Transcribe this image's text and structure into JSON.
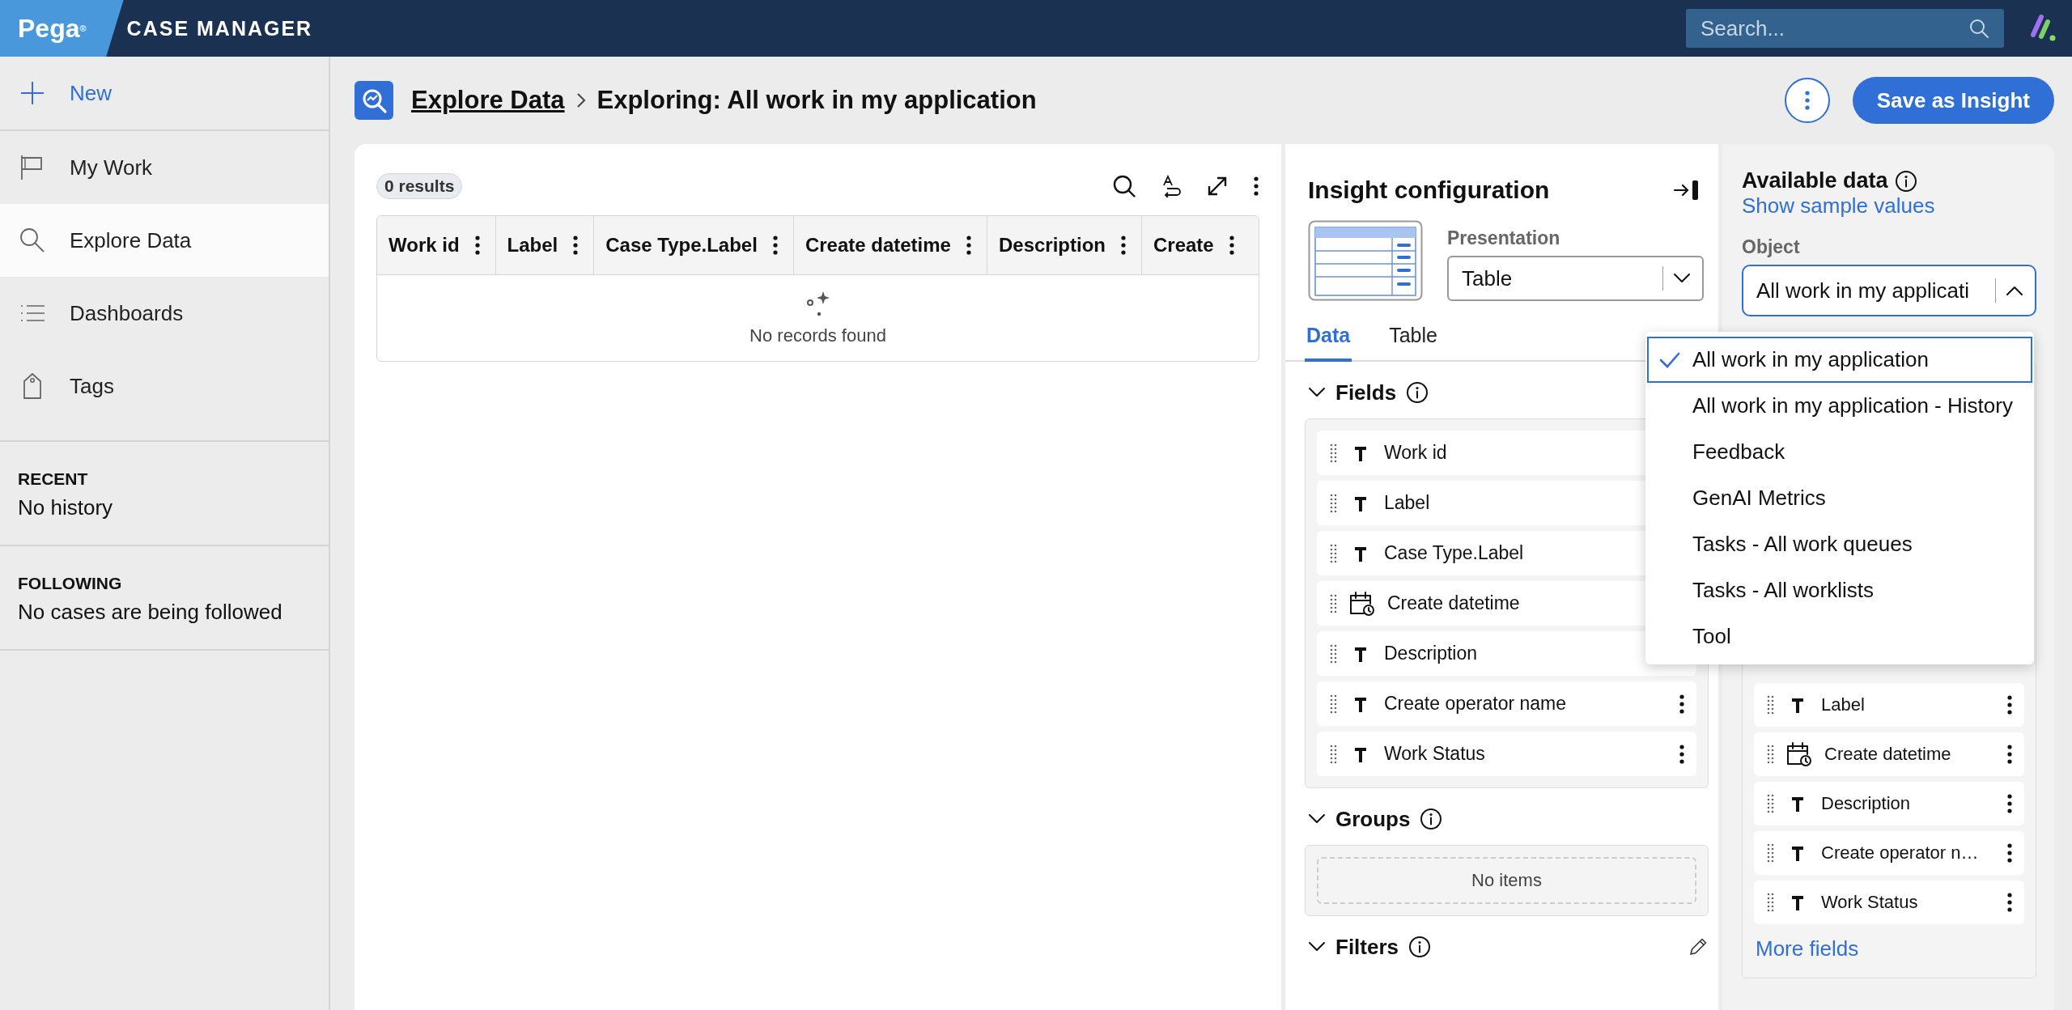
{
  "topbar": {
    "logo": "Pega$^{®}$",
    "app_title": "CASE MANAGER",
    "search": {
      "placeholder": "Search..."
    }
  },
  "sidebar": {
    "items": [
      {
        "label": "New",
        "kind": "new",
        "selected": false
      },
      {
        "label": "My Work",
        "kind": "flag",
        "selected": false
      },
      {
        "label": "Explore Data",
        "kind": "search",
        "selected": true
      },
      {
        "label": "Dashboards",
        "kind": "list",
        "selected": false
      },
      {
        "label": "Tags",
        "kind": "tag",
        "selected": false
      }
    ],
    "recent": {
      "heading": "RECENT",
      "text": "No history"
    },
    "following": {
      "heading": "FOLLOWING",
      "text": "No cases are being followed"
    }
  },
  "header": {
    "breadcrumb": "Explore Data",
    "title": "Exploring: All work in my application",
    "save_button": "Save as Insight"
  },
  "results": {
    "count": "0 results",
    "columns": [
      "Work id",
      "Label",
      "Case Type.Label",
      "Create datetime",
      "Description",
      "Create"
    ],
    "empty_text": "No records found"
  },
  "insight_config": {
    "title": "Insight configuration",
    "presentation": {
      "label": "Presentation",
      "value": "Table"
    },
    "tabs": [
      {
        "label": "Data",
        "selected": true
      },
      {
        "label": "Table",
        "selected": false
      }
    ],
    "fields": {
      "title": "Fields",
      "items": [
        {
          "label": "Work id",
          "kind": "text"
        },
        {
          "label": "Label",
          "kind": "text"
        },
        {
          "label": "Case Type.Label",
          "kind": "text"
        },
        {
          "label": "Create datetime",
          "kind": "datetime"
        },
        {
          "label": "Description",
          "kind": "text"
        },
        {
          "label": "Create operator name",
          "kind": "text"
        },
        {
          "label": "Work Status",
          "kind": "text"
        }
      ]
    },
    "groups": {
      "title": "Groups",
      "empty_text": "No items"
    },
    "filters": {
      "title": "Filters"
    }
  },
  "available_data": {
    "title": "Available data",
    "link": "Show sample values",
    "object": {
      "label": "Object",
      "value": "All work in my applicati",
      "expanded": true,
      "options": [
        {
          "label": "All work in my application",
          "selected": true
        },
        {
          "label": "All work in my application - History",
          "selected": false
        },
        {
          "label": "Feedback",
          "selected": false
        },
        {
          "label": "GenAI Metrics",
          "selected": false
        },
        {
          "label": "Tasks - All work queues",
          "selected": false
        },
        {
          "label": "Tasks - All worklists",
          "selected": false
        },
        {
          "label": "Tool",
          "selected": false
        }
      ]
    },
    "fields": [
      {
        "label": "Label",
        "kind": "text"
      },
      {
        "label": "Create datetime",
        "kind": "datetime"
      },
      {
        "label": "Description",
        "kind": "text"
      },
      {
        "label": "Create operator n…",
        "kind": "text"
      },
      {
        "label": "Work Status",
        "kind": "text"
      }
    ],
    "more_link": "More fields"
  }
}
